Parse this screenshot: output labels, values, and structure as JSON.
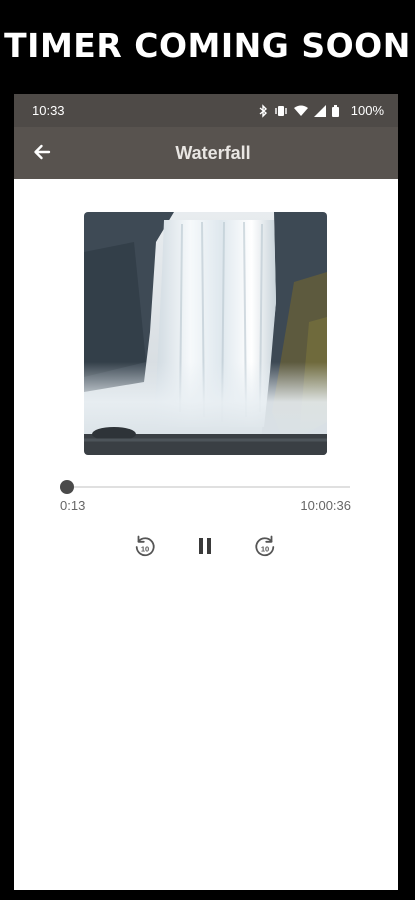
{
  "banner": {
    "text": "TIMER COMING SOON"
  },
  "status_bar": {
    "time": "10:33",
    "battery": "100%",
    "icons": [
      "bluetooth-icon",
      "vibrate-icon",
      "wifi-icon",
      "signal-icon",
      "battery-icon"
    ]
  },
  "app_bar": {
    "title": "Waterfall",
    "back_icon": "arrow-left-icon"
  },
  "player": {
    "artwork": "waterfall-image",
    "elapsed": "0:13",
    "duration": "10:00:36",
    "progress_fraction": 0.0,
    "controls": {
      "rewind": {
        "icon": "replay-10-icon",
        "label": "10"
      },
      "play_pause": {
        "icon": "pause-icon"
      },
      "forward": {
        "icon": "forward-10-icon",
        "label": "10"
      }
    }
  },
  "colors": {
    "status_bar": "#4e4a47",
    "app_bar": "#58534f",
    "accent": "#4a4a4a"
  }
}
